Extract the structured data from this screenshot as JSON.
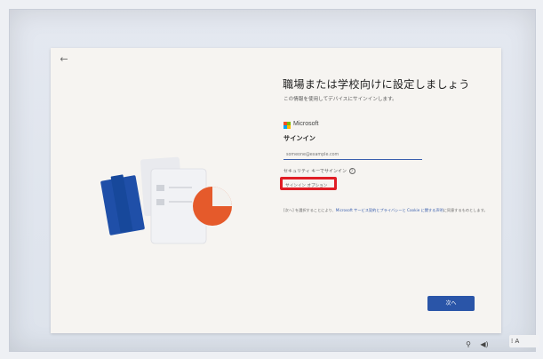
{
  "header": {
    "title": "職場または学校向けに設定しましょう",
    "subtitle": "この情報を使用してデバイスにサインインします。"
  },
  "brand": {
    "name": "Microsoft",
    "logo_colors": [
      "#f25022",
      "#7fba00",
      "#00a4ef",
      "#ffb900"
    ]
  },
  "signin": {
    "heading": "サインイン",
    "email_placeholder": "someone@example.com",
    "security_key_link": "セキュリティ キーでサインイン",
    "security_key_help": "?",
    "options_link": "サインイン オプション"
  },
  "consent": {
    "prefix": "[次へ] を選択することにより、",
    "link_text": "Microsoft サービス契約とプライバシーと Cookie に関する声明",
    "suffix": "に同意するものとします。"
  },
  "buttons": {
    "next_label": "次へ"
  },
  "taskbar": {
    "ime_label": "A"
  },
  "colors": {
    "accent": "#2a55a8",
    "highlight": "#e01d25",
    "panel_bg": "#f6f4f1"
  }
}
